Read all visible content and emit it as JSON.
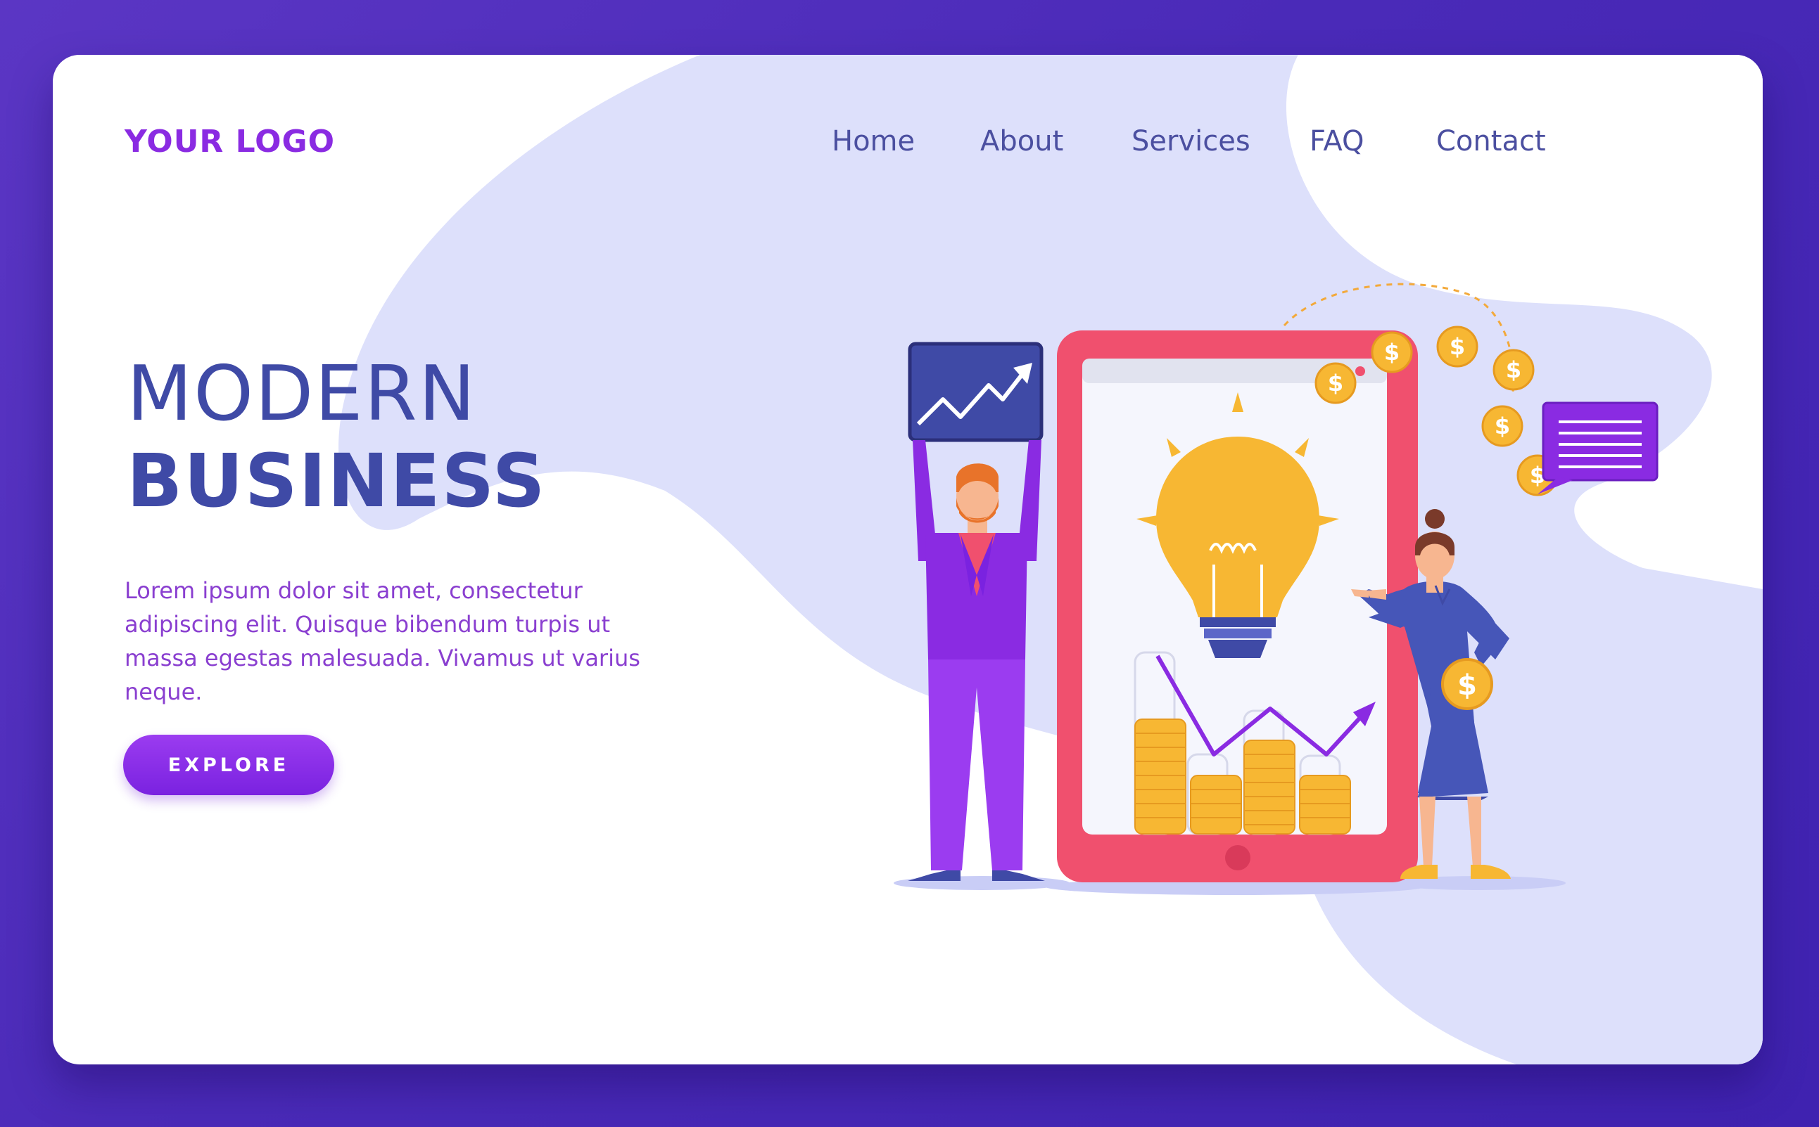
{
  "logo": "YOUR LOGO",
  "nav": {
    "home": "Home",
    "about": "About",
    "services": "Services",
    "faq": "FAQ",
    "contact": "Contact"
  },
  "hero": {
    "title_line1": "MODERN",
    "title_line2": "BUSINESS",
    "description": "Lorem ipsum dolor sit amet, consectetur adipiscing elit. Quisque bibendum turpis ut massa egestas malesuada. Vivamus ut varius neque.",
    "cta_label": "EXPLORE"
  },
  "colors": {
    "accent": "#8a2be2",
    "heading": "#3f4aa6",
    "blob": "#dde0fb",
    "phone": "#f0506e",
    "coin": "#f7b733",
    "background": "#5b36c4"
  },
  "icons": {
    "illustration": "business-growth-illustration",
    "chart_board": "trend-up-chart-icon",
    "lightbulb": "lightbulb-icon",
    "coin": "dollar-coin-icon",
    "message": "chat-bubble-icon"
  }
}
